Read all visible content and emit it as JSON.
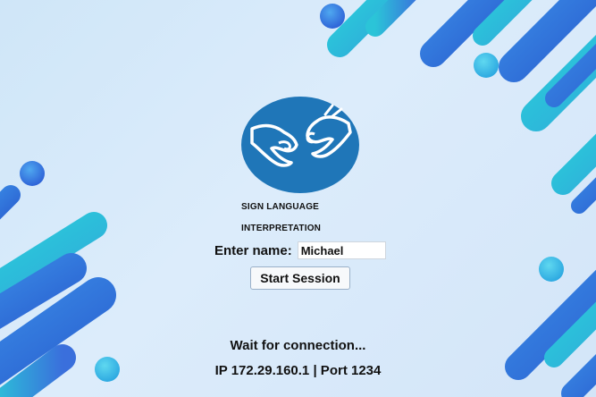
{
  "logo": {
    "icon": "sign-language-hands-icon",
    "caption_line1": "SIGN LANGUAGE",
    "caption_line2": "INTERPRETATION",
    "color": "#1f76b8"
  },
  "form": {
    "name_label": "Enter name:",
    "name_value": "Michael",
    "start_button_label": "Start Session"
  },
  "status": {
    "wait_text": "Wait for connection...",
    "connection_text": "IP 172.29.160.1 | Port 1234"
  },
  "colors": {
    "background": "#d8eaf9",
    "accent_blue": "#2f6fd8",
    "accent_cyan": "#2cc0d8"
  }
}
